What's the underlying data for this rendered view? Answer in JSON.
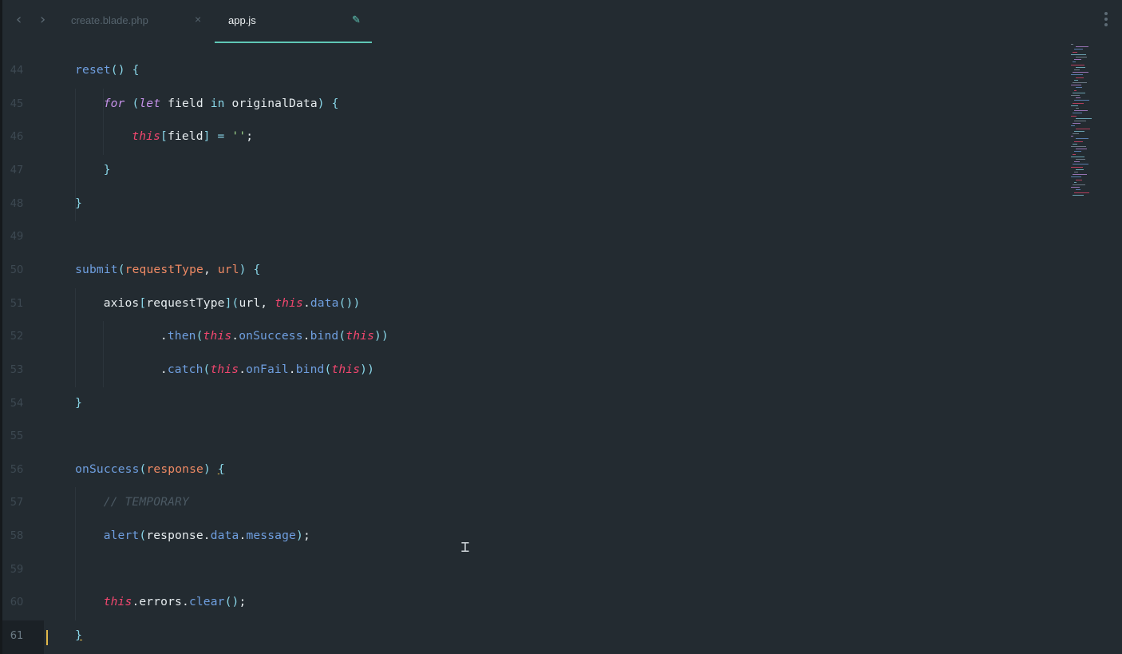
{
  "tabs": [
    {
      "label": "create.blade.php",
      "active": false,
      "close_icon": "×"
    },
    {
      "label": "app.js",
      "active": true,
      "modified_icon": "✎"
    }
  ],
  "nav": {
    "back_icon": "‹",
    "forward_icon": "›"
  },
  "colors": {
    "accent": "#5fc7b6",
    "background": "#232b31",
    "cursor": "#e0b84a"
  },
  "active_line": 61,
  "lines": [
    {
      "n": "44",
      "indent": 1,
      "tokens": [
        [
          "fn",
          "reset"
        ],
        [
          "pn",
          "()"
        ],
        [
          "tx",
          " "
        ],
        [
          "pn",
          "{"
        ]
      ]
    },
    {
      "n": "45",
      "indent": 2,
      "tokens": [
        [
          "kw",
          "for"
        ],
        [
          "tx",
          " "
        ],
        [
          "pn",
          "("
        ],
        [
          "kw",
          "let"
        ],
        [
          "tx",
          " field "
        ],
        [
          "op",
          "in"
        ],
        [
          "tx",
          " originalData"
        ],
        [
          "pn",
          ")"
        ],
        [
          "tx",
          " "
        ],
        [
          "pn",
          "{"
        ]
      ]
    },
    {
      "n": "46",
      "indent": 3,
      "tokens": [
        [
          "this",
          "this"
        ],
        [
          "pn",
          "["
        ],
        [
          "tx",
          "field"
        ],
        [
          "pn",
          "]"
        ],
        [
          "tx",
          " "
        ],
        [
          "op",
          "="
        ],
        [
          "tx",
          " "
        ],
        [
          "str",
          "''"
        ],
        [
          "tx",
          ";"
        ]
      ]
    },
    {
      "n": "47",
      "indent": 2,
      "tokens": [
        [
          "pn",
          "}"
        ]
      ]
    },
    {
      "n": "48",
      "indent": 1,
      "tokens": [
        [
          "pn",
          "}"
        ]
      ]
    },
    {
      "n": "49",
      "indent": 0,
      "tokens": []
    },
    {
      "n": "50",
      "indent": 1,
      "tokens": [
        [
          "fn",
          "submit"
        ],
        [
          "pn",
          "("
        ],
        [
          "par",
          "requestType"
        ],
        [
          "tx",
          ", "
        ],
        [
          "par",
          "url"
        ],
        [
          "pn",
          ")"
        ],
        [
          "tx",
          " "
        ],
        [
          "pn",
          "{"
        ]
      ]
    },
    {
      "n": "51",
      "indent": 2,
      "tokens": [
        [
          "tx",
          "axios"
        ],
        [
          "pn",
          "["
        ],
        [
          "tx",
          "requestType"
        ],
        [
          "pn",
          "]("
        ],
        [
          "tx",
          "url, "
        ],
        [
          "this",
          "this"
        ],
        [
          "tx",
          "."
        ],
        [
          "prop",
          "data"
        ],
        [
          "pn",
          "())"
        ]
      ]
    },
    {
      "n": "52",
      "indent": 4,
      "tokens": [
        [
          "tx",
          "."
        ],
        [
          "prop",
          "then"
        ],
        [
          "pn",
          "("
        ],
        [
          "this",
          "this"
        ],
        [
          "tx",
          "."
        ],
        [
          "prop",
          "onSuccess"
        ],
        [
          "tx",
          "."
        ],
        [
          "prop",
          "bind"
        ],
        [
          "pn",
          "("
        ],
        [
          "this",
          "this"
        ],
        [
          "pn",
          "))"
        ]
      ]
    },
    {
      "n": "53",
      "indent": 4,
      "tokens": [
        [
          "tx",
          "."
        ],
        [
          "prop",
          "catch"
        ],
        [
          "pn",
          "("
        ],
        [
          "this",
          "this"
        ],
        [
          "tx",
          "."
        ],
        [
          "prop",
          "onFail"
        ],
        [
          "tx",
          "."
        ],
        [
          "prop",
          "bind"
        ],
        [
          "pn",
          "("
        ],
        [
          "this",
          "this"
        ],
        [
          "pn",
          "))"
        ]
      ]
    },
    {
      "n": "54",
      "indent": 1,
      "tokens": [
        [
          "pn",
          "}"
        ]
      ]
    },
    {
      "n": "55",
      "indent": 0,
      "tokens": []
    },
    {
      "n": "56",
      "indent": 1,
      "tokens": [
        [
          "fn",
          "onSuccess"
        ],
        [
          "pn",
          "("
        ],
        [
          "par",
          "response"
        ],
        [
          "pn",
          ")"
        ],
        [
          "tx",
          " "
        ],
        [
          "pnu",
          "{"
        ]
      ]
    },
    {
      "n": "57",
      "indent": 2,
      "tokens": [
        [
          "cm",
          "// TEMPORARY"
        ]
      ]
    },
    {
      "n": "58",
      "indent": 2,
      "tokens": [
        [
          "fn",
          "alert"
        ],
        [
          "pn",
          "("
        ],
        [
          "tx",
          "response."
        ],
        [
          "prop",
          "data"
        ],
        [
          "tx",
          "."
        ],
        [
          "prop",
          "message"
        ],
        [
          "pn",
          ")"
        ],
        [
          "tx",
          ";"
        ]
      ]
    },
    {
      "n": "59",
      "indent": 0,
      "tokens": []
    },
    {
      "n": "60",
      "indent": 2,
      "tokens": [
        [
          "this",
          "this"
        ],
        [
          "tx",
          ".errors."
        ],
        [
          "prop",
          "clear"
        ],
        [
          "pn",
          "()"
        ],
        [
          "tx",
          ";"
        ]
      ]
    },
    {
      "n": "61",
      "indent": 1,
      "tokens": [
        [
          "pnu",
          "}"
        ]
      ]
    }
  ]
}
